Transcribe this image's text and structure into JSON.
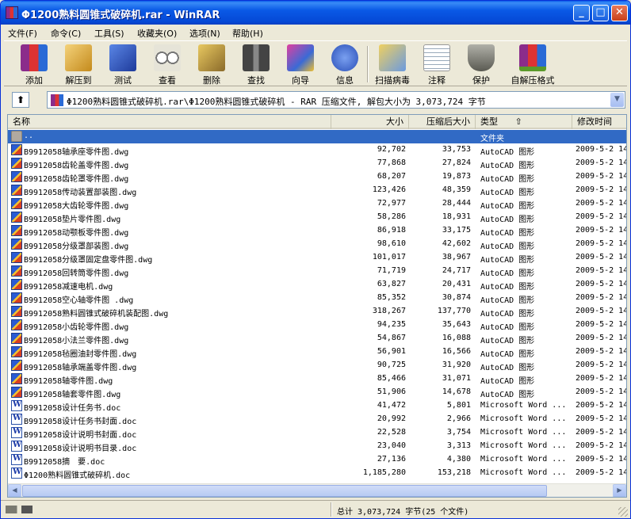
{
  "window": {
    "title": "Φ1200熟料圆锥式破碎机.rar - WinRAR",
    "min_symbol": "_",
    "max_symbol": "□",
    "close_symbol": "✕"
  },
  "menu": [
    {
      "label": "文件(F)"
    },
    {
      "label": "命令(C)"
    },
    {
      "label": "工具(S)"
    },
    {
      "label": "收藏夹(O)"
    },
    {
      "label": "选项(N)"
    },
    {
      "label": "帮助(H)"
    }
  ],
  "toolbar": [
    {
      "label": "添加",
      "icon": "add-archive-icon",
      "color": "#8b2c8b"
    },
    {
      "label": "解压到",
      "icon": "extract-to-icon",
      "color": "#d9a530"
    },
    {
      "label": "测试",
      "icon": "test-icon",
      "color": "#2a4fb8"
    },
    {
      "label": "查看",
      "icon": "view-glasses-icon",
      "color": "#9c9c9c"
    },
    {
      "label": "删除",
      "icon": "delete-icon",
      "color": "#c9a23a"
    },
    {
      "label": "查找",
      "icon": "binoculars-icon",
      "color": "#3b3b3b"
    },
    {
      "label": "向导",
      "icon": "wizard-icon",
      "color": "#c23a8c"
    },
    {
      "label": "信息",
      "icon": "info-icon",
      "color": "#3a5fc8"
    },
    {
      "label": "扫描病毒",
      "icon": "virus-scan-icon",
      "color": "#d4b030"
    },
    {
      "label": "注释",
      "icon": "comment-icon",
      "color": "#e8e8e0"
    },
    {
      "label": "保护",
      "icon": "shield-icon",
      "color": "#8a8a80"
    },
    {
      "label": "自解压格式",
      "icon": "sfx-icon",
      "color": "#5a9a2a"
    }
  ],
  "address": {
    "up_symbol": "⬆",
    "text": "Φ1200熟料圆锥式破碎机.rar\\Φ1200熟料圆锥式破碎机 - RAR 压缩文件, 解包大小为 3,073,724 字节",
    "drop_symbol": "▼"
  },
  "columns": {
    "name": "名称",
    "size": "大小",
    "packed": "压缩后大小",
    "type": "类型",
    "sort_symbol": "⇧",
    "modified": "修改时间"
  },
  "files": [
    {
      "name": "..",
      "size": "",
      "packed": "",
      "type": "文件夹",
      "modified": "",
      "kind": "folder"
    },
    {
      "name": "B9912058轴承座零件图.dwg",
      "size": "92,702",
      "packed": "33,753",
      "type": "AutoCAD 图形",
      "modified": "2009-5-2 14",
      "kind": "dwg"
    },
    {
      "name": "B9912058齿轮盖零件图.dwg",
      "size": "77,868",
      "packed": "27,824",
      "type": "AutoCAD 图形",
      "modified": "2009-5-2 14",
      "kind": "dwg"
    },
    {
      "name": "B9912058齿轮罩零件图.dwg",
      "size": "68,207",
      "packed": "19,873",
      "type": "AutoCAD 图形",
      "modified": "2009-5-2 14",
      "kind": "dwg"
    },
    {
      "name": "B9912058传动装置部装图.dwg",
      "size": "123,426",
      "packed": "48,359",
      "type": "AutoCAD 图形",
      "modified": "2009-5-2 14",
      "kind": "dwg"
    },
    {
      "name": "B9912058大齿轮零件图.dwg",
      "size": "72,977",
      "packed": "28,444",
      "type": "AutoCAD 图形",
      "modified": "2009-5-2 14",
      "kind": "dwg"
    },
    {
      "name": "B9912058垫片零件图.dwg",
      "size": "58,286",
      "packed": "18,931",
      "type": "AutoCAD 图形",
      "modified": "2009-5-2 14",
      "kind": "dwg"
    },
    {
      "name": "B9912058动颚板零件图.dwg",
      "size": "86,918",
      "packed": "33,175",
      "type": "AutoCAD 图形",
      "modified": "2009-5-2 14",
      "kind": "dwg"
    },
    {
      "name": "B9912058分级罩部装图.dwg",
      "size": "98,610",
      "packed": "42,602",
      "type": "AutoCAD 图形",
      "modified": "2009-5-2 14",
      "kind": "dwg"
    },
    {
      "name": "B9912058分级罩固定盘零件图.dwg",
      "size": "101,017",
      "packed": "38,967",
      "type": "AutoCAD 图形",
      "modified": "2009-5-2 14",
      "kind": "dwg"
    },
    {
      "name": "B9912058回转筒零件图.dwg",
      "size": "71,719",
      "packed": "24,717",
      "type": "AutoCAD 图形",
      "modified": "2009-5-2 14",
      "kind": "dwg"
    },
    {
      "name": "B9912058减速电机.dwg",
      "size": "63,827",
      "packed": "20,431",
      "type": "AutoCAD 图形",
      "modified": "2009-5-2 14",
      "kind": "dwg"
    },
    {
      "name": "B9912058空心轴零件图 .dwg",
      "size": "85,352",
      "packed": "30,874",
      "type": "AutoCAD 图形",
      "modified": "2009-5-2 14",
      "kind": "dwg"
    },
    {
      "name": "B9912058熟料圆锥式破碎机装配图.dwg",
      "size": "318,267",
      "packed": "137,770",
      "type": "AutoCAD 图形",
      "modified": "2009-5-2 14",
      "kind": "dwg"
    },
    {
      "name": "B9912058小齿轮零件图.dwg",
      "size": "94,235",
      "packed": "35,643",
      "type": "AutoCAD 图形",
      "modified": "2009-5-2 14",
      "kind": "dwg"
    },
    {
      "name": "B9912058小法兰零件图.dwg",
      "size": "54,867",
      "packed": "16,088",
      "type": "AutoCAD 图形",
      "modified": "2009-5-2 14",
      "kind": "dwg"
    },
    {
      "name": "B9912058毡圈油封零件图.dwg",
      "size": "56,901",
      "packed": "16,566",
      "type": "AutoCAD 图形",
      "modified": "2009-5-2 14",
      "kind": "dwg"
    },
    {
      "name": "B9912058轴承端盖零件图.dwg",
      "size": "90,725",
      "packed": "31,920",
      "type": "AutoCAD 图形",
      "modified": "2009-5-2 14",
      "kind": "dwg"
    },
    {
      "name": "B9912058轴零件图.dwg",
      "size": "85,466",
      "packed": "31,071",
      "type": "AutoCAD 图形",
      "modified": "2009-5-2 14",
      "kind": "dwg"
    },
    {
      "name": "B9912058轴套零件图.dwg",
      "size": "51,906",
      "packed": "14,678",
      "type": "AutoCAD 图形",
      "modified": "2009-5-2 14",
      "kind": "dwg"
    },
    {
      "name": "B9912058设计任务书.doc",
      "size": "41,472",
      "packed": "5,801",
      "type": "Microsoft Word ...",
      "modified": "2009-5-2 14",
      "kind": "doc"
    },
    {
      "name": "B9912058设计任务书封面.doc",
      "size": "20,992",
      "packed": "2,966",
      "type": "Microsoft Word ...",
      "modified": "2009-5-2 14",
      "kind": "doc"
    },
    {
      "name": "B9912058设计说明书封面.doc",
      "size": "22,528",
      "packed": "3,754",
      "type": "Microsoft Word ...",
      "modified": "2009-5-2 14",
      "kind": "doc"
    },
    {
      "name": "B9912058设计说明书目录.doc",
      "size": "23,040",
      "packed": "3,313",
      "type": "Microsoft Word ...",
      "modified": "2009-5-2 14",
      "kind": "doc"
    },
    {
      "name": "B9912058摘　要.doc",
      "size": "27,136",
      "packed": "4,380",
      "type": "Microsoft Word ...",
      "modified": "2009-5-2 14",
      "kind": "doc"
    },
    {
      "name": "Φ1200熟料圆锥式破碎机.doc",
      "size": "1,185,280",
      "packed": "153,218",
      "type": "Microsoft Word ...",
      "modified": "2009-5-2 14",
      "kind": "doc"
    }
  ],
  "scroll": {
    "left_symbol": "◀",
    "right_symbol": "▶"
  },
  "status": {
    "text": "总计 3,073,724 字节(25 个文件)"
  }
}
